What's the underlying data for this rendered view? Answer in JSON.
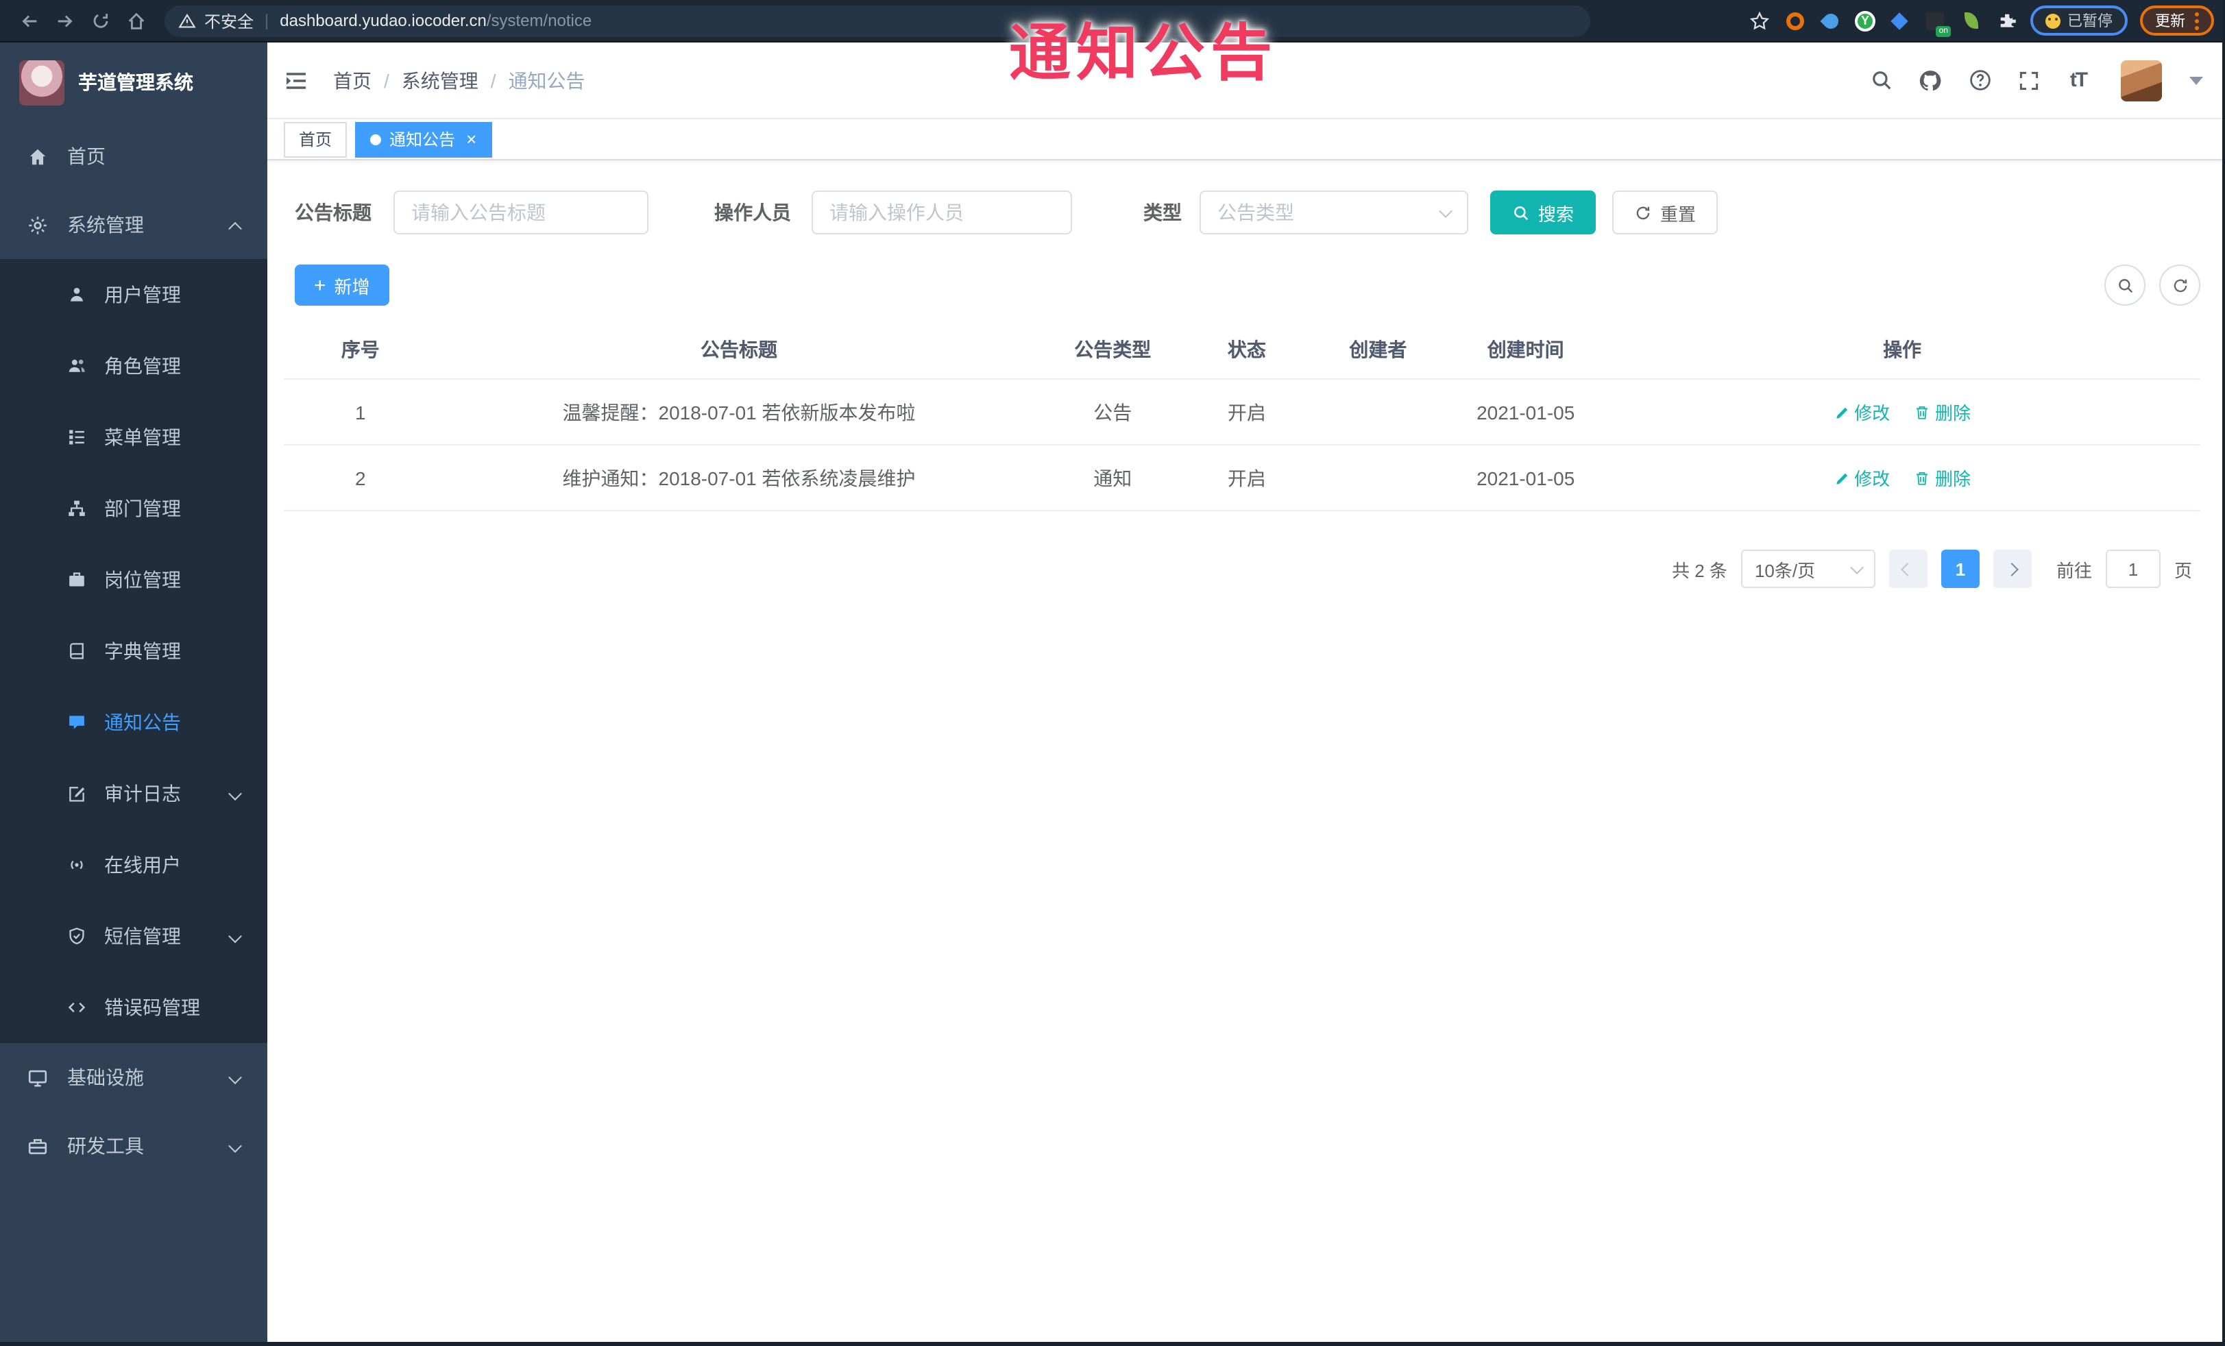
{
  "colors": {
    "accent": "#409eff",
    "teal": "#13b5b1",
    "overlay_red": "#ef3b5f",
    "sidebar_bg": "#304156",
    "submenu_bg": "#1f2d3d"
  },
  "overlay": {
    "text": "通知公告"
  },
  "browser": {
    "security": "不安全",
    "host": "dashboard.yudao.iocoder.cn",
    "path": "/system/notice",
    "ext_y": "Y",
    "ext_on_badge": "on",
    "paused": "已暂停",
    "update": "更新"
  },
  "sidebar": {
    "title": "芋道管理系统",
    "top": [
      {
        "label": "首页"
      },
      {
        "label": "系统管理"
      },
      {
        "label": "基础设施"
      },
      {
        "label": "研发工具"
      }
    ],
    "submenu": [
      {
        "label": "用户管理"
      },
      {
        "label": "角色管理"
      },
      {
        "label": "菜单管理"
      },
      {
        "label": "部门管理"
      },
      {
        "label": "岗位管理"
      },
      {
        "label": "字典管理"
      },
      {
        "label": "通知公告"
      },
      {
        "label": "审计日志"
      },
      {
        "label": "在线用户"
      },
      {
        "label": "短信管理"
      },
      {
        "label": "错误码管理"
      }
    ]
  },
  "header": {
    "crumbs": [
      "首页",
      "系统管理",
      "通知公告"
    ],
    "font_label": "tT"
  },
  "tabs": [
    {
      "label": "首页"
    },
    {
      "label": "通知公告"
    }
  ],
  "filters": {
    "title_label": "公告标题",
    "title_placeholder": "请输入公告标题",
    "operator_label": "操作人员",
    "operator_placeholder": "请输入操作人员",
    "type_label": "类型",
    "type_placeholder": "公告类型",
    "search": "搜索",
    "reset": "重置"
  },
  "toolbar": {
    "add": "新增"
  },
  "table": {
    "columns": [
      "序号",
      "公告标题",
      "公告类型",
      "状态",
      "创建者",
      "创建时间",
      "操作"
    ],
    "actions": {
      "edit": "修改",
      "delete": "删除"
    },
    "rows": [
      {
        "no": "1",
        "title": "温馨提醒：2018-07-01 若依新版本发布啦",
        "type": "公告",
        "status": "开启",
        "creator": "",
        "time": "2021-01-05"
      },
      {
        "no": "2",
        "title": "维护通知：2018-07-01 若依系统凌晨维护",
        "type": "通知",
        "status": "开启",
        "creator": "",
        "time": "2021-01-05"
      }
    ]
  },
  "pagination": {
    "total": "共 2 条",
    "size": "10条/页",
    "page": "1",
    "goto": "前往",
    "goto_value": "1",
    "unit": "页"
  }
}
